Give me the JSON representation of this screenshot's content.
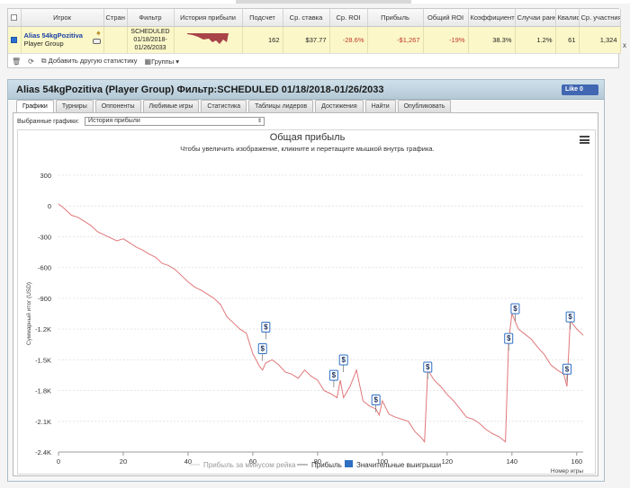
{
  "stats_table": {
    "headers": [
      "",
      "Игрок",
      "Стран",
      "Фильтр",
      "История прибыли",
      "Подсчет",
      "Ср. ставка",
      "Ср. ROI",
      "Прибыль",
      "Общий ROI",
      "Коэффициент",
      "Случаи ранн",
      "Квалиф",
      "Ср. участния"
    ],
    "row": {
      "player_name": "Alias 54kgPozitiva",
      "player_group": "Player Group",
      "filter_line1": "SCHEDULED",
      "filter_line2": "01/18/2018-",
      "filter_line3": "01/26/2033",
      "count": "162",
      "avg_stake": "$37.77",
      "avg_roi": "-28.6%",
      "profit": "-$1,267",
      "total_roi": "-19%",
      "coefficient": "38.3%",
      "early_cases": "1.2%",
      "qualif": "61",
      "avg_entrants": "1,324",
      "remove": "x"
    },
    "tools": {
      "add_stat": "Добавить другую статистику",
      "groups": "Группы"
    }
  },
  "panel": {
    "title": "Alias 54kgPozitiva (Player Group) Фильтр:SCHEDULED 01/18/2018-01/26/2033",
    "like_label": "Like 0",
    "tabs": [
      "Графики",
      "Турниры",
      "Оппоненты",
      "Любимые игры",
      "Статистика",
      "Таблицы лидеров",
      "Достижения",
      "Найти",
      "Опубликовать"
    ],
    "selected_graph_label": "Выбранные графики:",
    "selected_graph_value": "История прибыли"
  },
  "chart_data": {
    "type": "line",
    "title": "Общая прибыль",
    "subtitle": "Чтобы увеличить изображение, кликните и перетащите мышкой внутрь графика.",
    "ylabel": "Суммарный итог (USD)",
    "xlabel": "Номер игры",
    "ylim": [
      -2400,
      300
    ],
    "xlim": [
      0,
      162
    ],
    "y_ticks": [
      "300",
      "0",
      "-300",
      "-600",
      "-900",
      "-1.2K",
      "-1.5K",
      "-1.8K",
      "-2.1K",
      "-2.4K"
    ],
    "x_ticks": [
      "0",
      "20",
      "40",
      "60",
      "80",
      "100",
      "120",
      "140",
      "160"
    ],
    "legend": [
      "Прибыль за минусом рейка",
      "Прибыль",
      "Значительные выигрыши"
    ],
    "series_color": "#e0777a",
    "big_win_color": "#2f6fc4",
    "x": [
      0,
      2,
      4,
      6,
      8,
      10,
      12,
      14,
      16,
      18,
      20,
      22,
      24,
      26,
      28,
      30,
      32,
      34,
      36,
      38,
      40,
      42,
      44,
      46,
      48,
      50,
      52,
      54,
      56,
      58,
      60,
      62,
      63,
      64,
      66,
      68,
      70,
      72,
      74,
      76,
      78,
      80,
      82,
      84,
      86,
      87,
      88,
      90,
      92,
      94,
      96,
      98,
      99,
      100,
      102,
      104,
      106,
      108,
      110,
      112,
      113,
      114,
      116,
      118,
      120,
      122,
      124,
      126,
      128,
      130,
      132,
      134,
      136,
      138,
      139,
      140,
      142,
      144,
      146,
      148,
      150,
      152,
      154,
      156,
      157,
      158,
      160,
      162
    ],
    "y": [
      20,
      -30,
      -90,
      -110,
      -150,
      -190,
      -250,
      -280,
      -310,
      -340,
      -320,
      -360,
      -400,
      -430,
      -470,
      -500,
      -560,
      -580,
      -620,
      -680,
      -740,
      -790,
      -820,
      -860,
      -900,
      -960,
      -1080,
      -1140,
      -1200,
      -1240,
      -1440,
      -1560,
      -1600,
      -1530,
      -1500,
      -1550,
      -1620,
      -1640,
      -1680,
      -1600,
      -1660,
      -1700,
      -1800,
      -1830,
      -1870,
      -1700,
      -1870,
      -1760,
      -1600,
      -1900,
      -1950,
      -1980,
      -2040,
      -1900,
      -2030,
      -2060,
      -2080,
      -2100,
      -2200,
      -2260,
      -2300,
      -1600,
      -1700,
      -1760,
      -1840,
      -1900,
      -1980,
      -2060,
      -2080,
      -2120,
      -2180,
      -2220,
      -2250,
      -2300,
      -1320,
      -1050,
      -1200,
      -1250,
      -1300,
      -1380,
      -1450,
      -1550,
      -1600,
      -1640,
      -1760,
      -1120,
      -1200,
      -1260
    ],
    "big_wins": [
      {
        "x": 63,
        "y": -1440
      },
      {
        "x": 64,
        "y": -1230
      },
      {
        "x": 85,
        "y": -1700
      },
      {
        "x": 88,
        "y": -1550
      },
      {
        "x": 98,
        "y": -1940
      },
      {
        "x": 114,
        "y": -1620
      },
      {
        "x": 139,
        "y": -1340
      },
      {
        "x": 141,
        "y": -1050
      },
      {
        "x": 157,
        "y": -1640
      },
      {
        "x": 158,
        "y": -1130
      }
    ],
    "big_win_label": "$"
  }
}
